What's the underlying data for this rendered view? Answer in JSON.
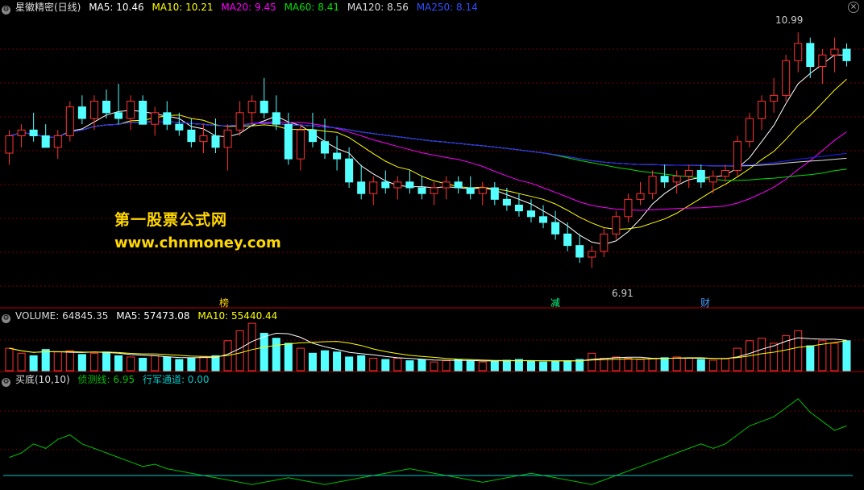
{
  "header": {
    "title": "星徽精密(日线)",
    "ma5": "MA5: 10.46",
    "ma10": "MA10: 10.21",
    "ma20": "MA20: 9.45",
    "ma60": "MA60: 8.41",
    "ma120": "MA120: 8.56",
    "ma250": "MA250: 8.14"
  },
  "volume_header": {
    "volume": "VOLUME: 64845.35",
    "ma5": "MA5: 57473.08",
    "ma10": "MA10: 55440.44"
  },
  "indicator_header": {
    "name": "买底(10,10)",
    "line1": "侦测线: 6.95",
    "line2": "行军通道: 0.00"
  },
  "watermark": {
    "line1": "第一股票公式网",
    "line2": "www.chnmoney.com"
  },
  "markers": {
    "m1": "榜",
    "m2": "减",
    "m3": "财"
  },
  "price_labels": {
    "high": "10.99",
    "low": "6.91"
  },
  "icons": {
    "settings": "gear-icon",
    "close": "close-icon"
  },
  "colors": {
    "up": "#ff3232",
    "down": "#54ffff",
    "ma5": "#ffffff",
    "ma10": "#ffff00",
    "ma20": "#ff00ff",
    "ma60": "#00e000",
    "ma120": "#dddddd",
    "ma250": "#2020ff",
    "divider": "#b00000",
    "grid": "#700000",
    "indicator": "#00c000",
    "channel": "#00c8c8"
  },
  "chart_data": {
    "type": "candlestick",
    "ylim": [
      6.5,
      11.3
    ],
    "low_index": 48,
    "candles": [
      [
        8.9,
        9.3,
        8.7,
        9.2
      ],
      [
        9.2,
        9.4,
        9.0,
        9.3
      ],
      [
        9.3,
        9.6,
        9.1,
        9.2
      ],
      [
        9.2,
        9.4,
        9.0,
        9.0
      ],
      [
        9.0,
        9.3,
        8.8,
        9.2
      ],
      [
        9.2,
        9.8,
        9.1,
        9.7
      ],
      [
        9.7,
        9.9,
        9.4,
        9.5
      ],
      [
        9.5,
        9.9,
        9.3,
        9.8
      ],
      [
        9.8,
        10.0,
        9.5,
        9.6
      ],
      [
        9.6,
        10.1,
        9.4,
        9.5
      ],
      [
        9.5,
        9.9,
        9.3,
        9.8
      ],
      [
        9.8,
        9.9,
        9.4,
        9.4
      ],
      [
        9.4,
        9.7,
        9.2,
        9.6
      ],
      [
        9.6,
        9.8,
        9.3,
        9.4
      ],
      [
        9.4,
        9.6,
        9.2,
        9.3
      ],
      [
        9.3,
        9.5,
        9.0,
        9.1
      ],
      [
        9.1,
        9.4,
        8.9,
        9.2
      ],
      [
        9.2,
        9.5,
        8.9,
        9.0
      ],
      [
        9.0,
        9.4,
        8.6,
        9.3
      ],
      [
        9.3,
        9.8,
        9.2,
        9.6
      ],
      [
        9.6,
        9.9,
        9.4,
        9.8
      ],
      [
        9.8,
        10.2,
        9.5,
        9.6
      ],
      [
        9.6,
        9.9,
        9.3,
        9.4
      ],
      [
        9.4,
        9.6,
        8.7,
        8.8
      ],
      [
        8.8,
        9.4,
        8.6,
        9.3
      ],
      [
        9.3,
        9.6,
        9.0,
        9.1
      ],
      [
        9.1,
        9.5,
        8.8,
        8.9
      ],
      [
        8.9,
        9.2,
        8.6,
        8.8
      ],
      [
        8.8,
        9.0,
        8.3,
        8.4
      ],
      [
        8.4,
        8.7,
        8.1,
        8.2
      ],
      [
        8.2,
        8.5,
        8.0,
        8.4
      ],
      [
        8.4,
        8.6,
        8.2,
        8.3
      ],
      [
        8.3,
        8.5,
        8.1,
        8.4
      ],
      [
        8.4,
        8.6,
        8.2,
        8.3
      ],
      [
        8.3,
        8.5,
        8.1,
        8.2
      ],
      [
        8.2,
        8.4,
        8.0,
        8.3
      ],
      [
        8.3,
        8.5,
        8.1,
        8.4
      ],
      [
        8.4,
        8.5,
        8.2,
        8.3
      ],
      [
        8.3,
        8.5,
        8.1,
        8.2
      ],
      [
        8.2,
        8.4,
        8.0,
        8.3
      ],
      [
        8.3,
        8.4,
        8.0,
        8.1
      ],
      [
        8.1,
        8.3,
        7.9,
        8.0
      ],
      [
        8.0,
        8.2,
        7.8,
        7.9
      ],
      [
        7.9,
        8.1,
        7.7,
        7.8
      ],
      [
        7.8,
        8.0,
        7.6,
        7.7
      ],
      [
        7.7,
        7.9,
        7.4,
        7.5
      ],
      [
        7.5,
        7.7,
        7.2,
        7.3
      ],
      [
        7.3,
        7.5,
        7.0,
        7.1
      ],
      [
        7.1,
        7.3,
        6.91,
        7.2
      ],
      [
        7.2,
        7.6,
        7.1,
        7.5
      ],
      [
        7.5,
        7.9,
        7.4,
        7.8
      ],
      [
        7.8,
        8.2,
        7.7,
        8.1
      ],
      [
        8.1,
        8.4,
        8.0,
        8.2
      ],
      [
        8.2,
        8.6,
        8.1,
        8.5
      ],
      [
        8.5,
        8.7,
        8.3,
        8.4
      ],
      [
        8.4,
        8.6,
        8.2,
        8.5
      ],
      [
        8.5,
        8.7,
        8.3,
        8.6
      ],
      [
        8.6,
        8.7,
        8.3,
        8.4
      ],
      [
        8.4,
        8.6,
        8.2,
        8.5
      ],
      [
        8.5,
        8.7,
        8.4,
        8.6
      ],
      [
        8.6,
        9.2,
        8.5,
        9.1
      ],
      [
        9.1,
        9.6,
        9.0,
        9.5
      ],
      [
        9.5,
        9.9,
        9.3,
        9.8
      ],
      [
        9.8,
        10.2,
        9.6,
        9.9
      ],
      [
        9.9,
        10.6,
        9.8,
        10.5
      ],
      [
        10.5,
        10.99,
        10.3,
        10.8
      ],
      [
        10.8,
        10.9,
        10.2,
        10.4
      ],
      [
        10.4,
        10.7,
        10.1,
        10.6
      ],
      [
        10.6,
        10.9,
        10.3,
        10.7
      ],
      [
        10.7,
        10.8,
        10.4,
        10.5
      ]
    ],
    "volume": [
      90,
      70,
      60,
      85,
      75,
      80,
      65,
      70,
      75,
      60,
      55,
      50,
      60,
      55,
      45,
      50,
      55,
      60,
      120,
      160,
      190,
      150,
      130,
      110,
      90,
      70,
      80,
      75,
      55,
      60,
      50,
      45,
      50,
      40,
      45,
      35,
      40,
      45,
      40,
      35,
      38,
      42,
      45,
      40,
      35,
      38,
      40,
      45,
      70,
      50,
      55,
      50,
      45,
      48,
      52,
      55,
      50,
      45,
      42,
      48,
      90,
      120,
      130,
      110,
      140,
      160,
      100,
      120,
      110,
      120
    ],
    "vol_ylim": [
      0,
      200
    ],
    "indicator": {
      "ylim": [
        -5,
        40
      ],
      "channel_level": 0,
      "detect_line": [
        8,
        10,
        14,
        12,
        16,
        18,
        14,
        12,
        10,
        8,
        6,
        4,
        5,
        3,
        2,
        1,
        0,
        -1,
        -2,
        -3,
        -4,
        -3,
        -2,
        -1,
        -2,
        -3,
        -4,
        -3,
        -2,
        -1,
        0,
        1,
        2,
        3,
        2,
        1,
        0,
        -1,
        -2,
        -3,
        -2,
        -1,
        0,
        1,
        0,
        -1,
        -2,
        -3,
        -4,
        -2,
        0,
        2,
        4,
        6,
        8,
        10,
        12,
        14,
        12,
        14,
        18,
        22,
        24,
        26,
        30,
        34,
        28,
        24,
        20,
        22
      ]
    }
  }
}
